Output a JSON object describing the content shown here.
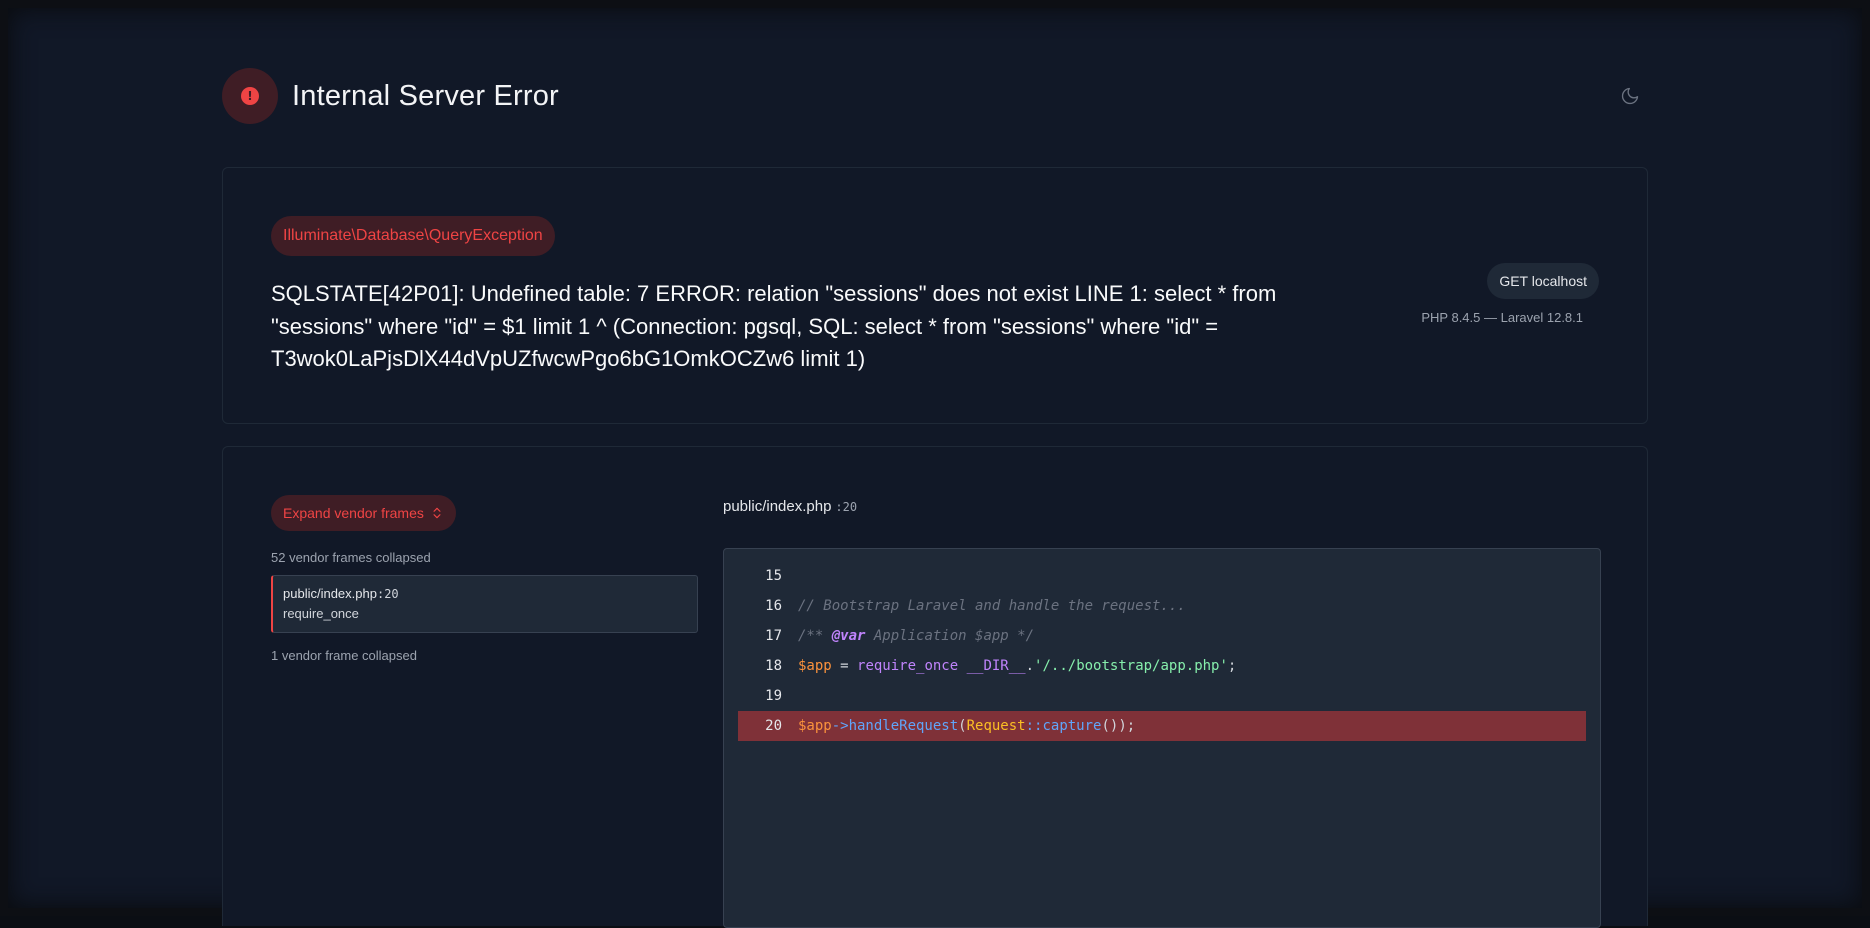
{
  "header": {
    "title": "Internal Server Error",
    "error_icon": "exclamation-icon",
    "theme_icon": "moon-icon"
  },
  "exception": {
    "class": "Illuminate\\Database\\QueryException",
    "message": "SQLSTATE[42P01]: Undefined table: 7 ERROR: relation \"sessions\" does not exist LINE 1: select * from \"sessions\" where \"id\" = $1 limit 1 ^ (Connection: pgsql, SQL: select * from \"sessions\" where \"id\" = T3wok0LaPjsDlX44dVpUZfwcwPgo6bG1OmkOCZw6 limit 1)",
    "request": "GET localhost",
    "versions": "PHP 8.4.5 — Laravel 12.8.1"
  },
  "trace": {
    "expand_label": "Expand vendor frames",
    "expand_icon": "chevron-up-down-icon",
    "collapsed_before": "52 vendor frames collapsed",
    "frame": {
      "file": "public/index.php",
      "line": ":20",
      "function": "require_once"
    },
    "collapsed_after": "1 vendor frame collapsed"
  },
  "code": {
    "file": "public/index.php",
    "line": ":20",
    "lines": [
      {
        "num": "15"
      },
      {
        "num": "16",
        "text": "// Bootstrap Laravel and handle the request..."
      },
      {
        "num": "17",
        "p1": "/** ",
        "p2": "@var",
        "p3": " Application $app */"
      },
      {
        "num": "18",
        "var": "$app",
        "op": " = ",
        "kw": "require_once ",
        "kw2": "__DIR__",
        "dot": ".",
        "str": "'/../bootstrap/app.php'",
        "end": ";"
      },
      {
        "num": "19"
      },
      {
        "num": "20",
        "var": "$app",
        "arrow": "->",
        "fn": "handleRequest",
        "lp": "(",
        "cls": "Request",
        "dc": "::",
        "fn2": "capture",
        "end": "());"
      }
    ]
  }
}
